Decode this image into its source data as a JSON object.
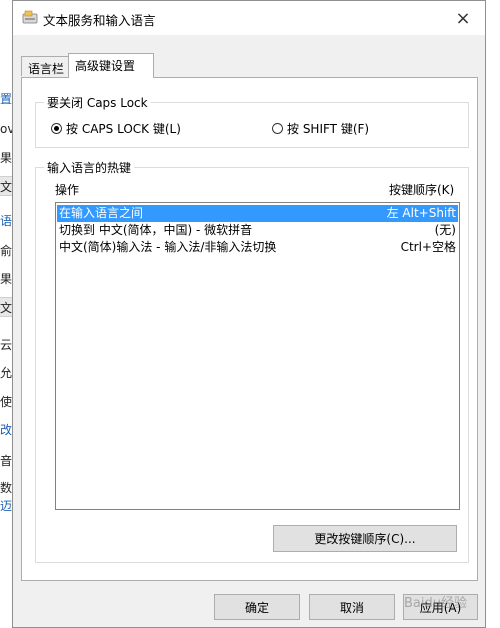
{
  "background": {
    "left_fragments": [
      "置",
      "ov",
      "果(",
      "文",
      "语",
      "俞入",
      "果(",
      "文",
      "云",
      "允",
      "使",
      "改",
      "音",
      "数",
      "迈"
    ]
  },
  "dialog": {
    "title": "文本服务和输入语言",
    "close_icon": "×",
    "tabs": [
      {
        "label": "语言栏"
      },
      {
        "label": "高级键设置"
      }
    ],
    "caps_group": {
      "title": "要关闭 Caps Lock",
      "options": [
        {
          "label": "按 CAPS LOCK 键(L)",
          "checked": true
        },
        {
          "label": "按 SHIFT 键(F)",
          "checked": false
        }
      ]
    },
    "hotkey_group": {
      "title": "输入语言的热键",
      "col_action": "操作",
      "col_keys": "按键顺序(K)",
      "rows": [
        {
          "action": "在输入语言之间",
          "keys": "左 Alt+Shift",
          "selected": true
        },
        {
          "action": "切换到 中文(简体，中国) - 微软拼音",
          "keys": "(无)",
          "selected": false
        },
        {
          "action": "中文(简体)输入法 - 输入法/非输入法切换",
          "keys": "Ctrl+空格",
          "selected": false
        }
      ],
      "change_button": "更改按键顺序(C)..."
    },
    "buttons": {
      "ok": "确定",
      "cancel": "取消",
      "apply": "应用(A)"
    },
    "watermark": "Baidu经验"
  }
}
